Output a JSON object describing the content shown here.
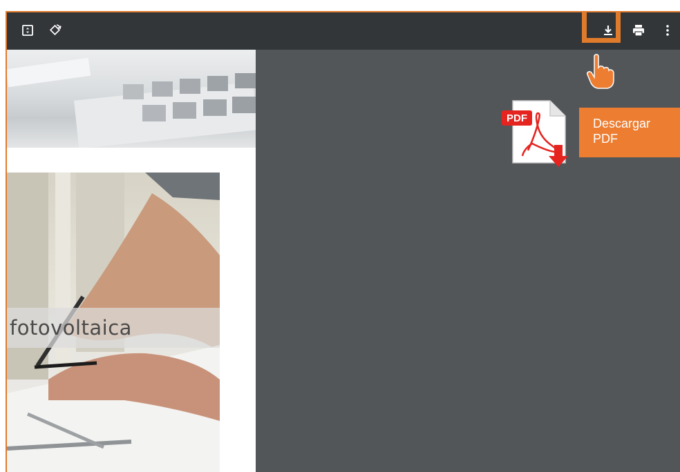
{
  "toolbar": {
    "left_icons": [
      "fit-page-icon",
      "rotate-icon"
    ],
    "right_icons": [
      "download-icon",
      "print-icon",
      "more-vert-icon"
    ]
  },
  "document": {
    "caption": "fotovoltaica"
  },
  "overlay": {
    "callout_line1": "Descargar",
    "callout_line2": "PDF",
    "pdf_badge": "PDF",
    "highlight_color": "#e07b2c",
    "callout_color": "#ec7d31"
  },
  "colors": {
    "toolbar_bg": "#323639",
    "viewer_bg": "#525659"
  }
}
